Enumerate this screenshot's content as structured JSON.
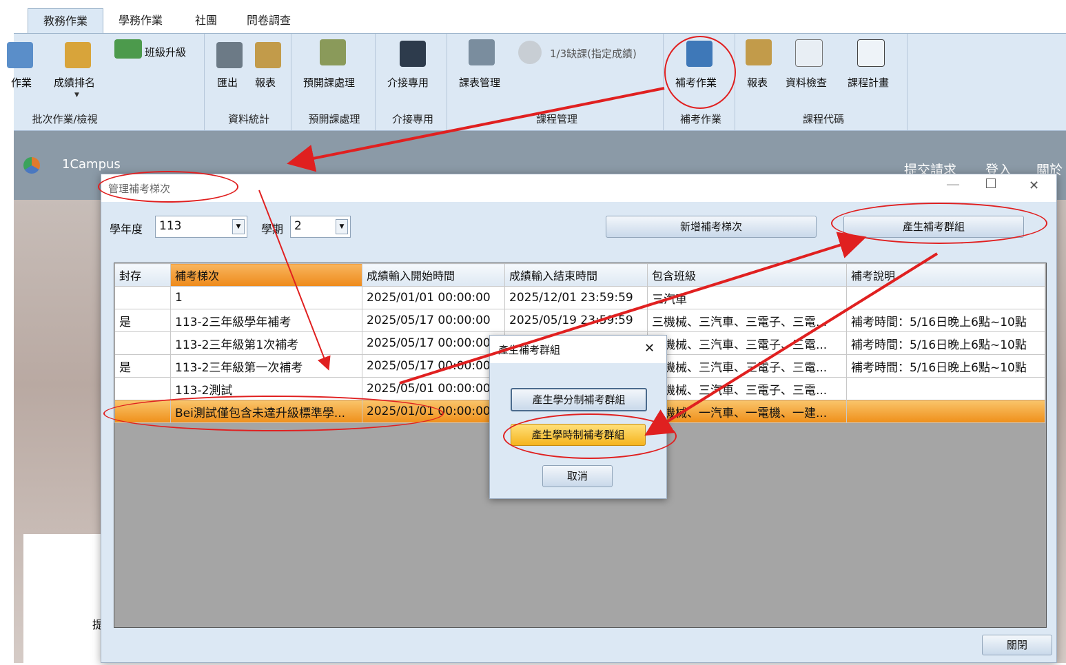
{
  "ribbon": {
    "tabs": [
      "教務作業",
      "學務作業",
      "社團",
      "問卷調查"
    ],
    "buttons": {
      "batch_ops": "作業",
      "ranking": "成績排名",
      "class_upgrade": "班級升級",
      "export": "匯出",
      "report": "報表",
      "preopen": "預開課處理",
      "api": "介接專用",
      "course_mgmt": "課表管理",
      "absence": "1/3缺課(指定成績)",
      "makeup": "補考作業",
      "report2": "報表",
      "data_check": "資料檢查",
      "curriculum": "課程計畫"
    },
    "groups": {
      "batch": "批次作業/檢視",
      "stats": "資料統計",
      "preopen": "預開課處理",
      "api": "介接專用",
      "course": "課程管理",
      "makeup": "補考作業",
      "code": "課程代碼"
    }
  },
  "background": {
    "app_name": "1Campus",
    "nav": [
      "提交請求",
      "登入",
      "關於"
    ],
    "card_text": "提"
  },
  "dialog": {
    "title": "管理補考梯次",
    "year_label": "學年度",
    "year_value": "113",
    "semester_label": "學期",
    "semester_value": "2",
    "add_button": "新增補考梯次",
    "generate_button": "產生補考群組",
    "close_button": "關閉",
    "columns": [
      "封存",
      "補考梯次",
      "成績輸入開始時間",
      "成績輸入結束時間",
      "包含班級",
      "補考說明"
    ],
    "rows": [
      [
        "",
        "1",
        "2025/01/01 00:00:00",
        "2025/12/01 23:59:59",
        "三汽車",
        ""
      ],
      [
        "是",
        "113-2三年級學年補考",
        "2025/05/17 00:00:00",
        "2025/05/19 23:59:59",
        "三機械、三汽車、三電子、三電...",
        "補考時間：5/16日晚上6點~10點"
      ],
      [
        "",
        "113-2三年級第1次補考",
        "2025/05/17 00:00:00",
        "",
        "三機械、三汽車、三電子、三電...",
        "補考時間：5/16日晚上6點~10點"
      ],
      [
        "是",
        "113-2三年級第一次補考",
        "2025/05/17 00:00:00",
        "",
        "三機械、三汽車、三電子、三電...",
        "補考時間：5/16日晚上6點~10點"
      ],
      [
        "",
        "113-2測試",
        "2025/05/01 00:00:00",
        "",
        "三機械、三汽車、三電子、三電...",
        ""
      ],
      [
        "",
        "Bei測試僅包含未達升級標準學...",
        "2025/01/01 00:00:00",
        "",
        "一機械、一汽車、一電機、一建...",
        ""
      ]
    ]
  },
  "subdialog": {
    "title": "產生補考群組",
    "credit_button": "產生學分制補考群組",
    "hour_button": "產生學時制補考群組",
    "cancel_button": "取消"
  }
}
